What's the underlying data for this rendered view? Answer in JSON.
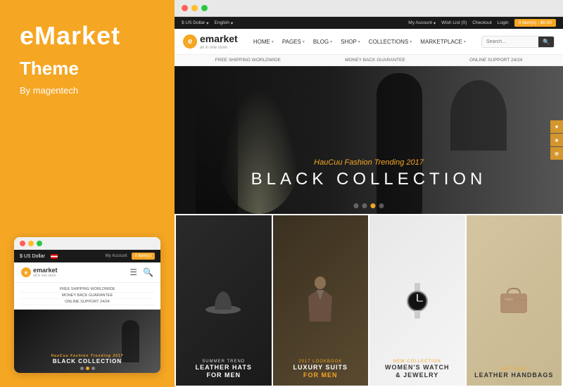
{
  "leftPanel": {
    "brandName": "eMarket",
    "themeLabel": "Theme",
    "byAuthor": "By magentech"
  },
  "mobileSite": {
    "currency": "$ US Dollar",
    "flag": "US",
    "account": "My Account",
    "cartLabel": "0 item(s)",
    "logoText": "emarket",
    "logoSub": "all in one store",
    "taglines": [
      "FREE SHIPPING WORLDWIDE",
      "MONEY BACK GUARANTEE",
      "ONLINE SUPPORT 24/24"
    ],
    "heroSub": "HauCuu Fashion Trending 2017",
    "heroMain": "BLACK COLLECTION"
  },
  "desktopSite": {
    "topbar": {
      "currency": "$ US Dollar",
      "english": "English",
      "account": "My Account",
      "wishlist": "Wish List (0)",
      "checkout": "Checkout",
      "login": "Login",
      "cart": "0 item(s) - $0.00"
    },
    "nav": {
      "logoText": "emarket",
      "logoSub": "all in one store",
      "menuItems": [
        "HOME",
        "PAGES",
        "BLOG",
        "SHOP",
        "COLLECTIONS",
        "MARKETPLACE"
      ],
      "searchPlaceholder": "Search..."
    },
    "taglines": [
      "FREE SHIPPING WORLDWIDE",
      "MONEY BACK GUARANTEE",
      "ONLINE SUPPORT 24/24"
    ],
    "hero": {
      "scriptText": "HauCuu Fashion Trending 2017",
      "mainText": "BLACK COLLECTION"
    },
    "products": [
      {
        "id": "hats",
        "tag": "Summer Trend",
        "title": "LEATHER HATS\nFOR MEN",
        "bgClass": "tile-hats"
      },
      {
        "id": "suits",
        "tag": "2017 Lookbook",
        "title": "LUXURY SUITS\nFOR MEN",
        "bgClass": "tile-suits",
        "accent": true
      },
      {
        "id": "watch",
        "tag": "New Collection",
        "title": "WOMEN'S WATCH\n& JEWELRY",
        "bgClass": "tile-watch",
        "dark": true
      },
      {
        "id": "handbags",
        "tag": "Hot Sale",
        "title": "LEATHER HANDBAGS",
        "bgClass": "tile-handbags",
        "dark": true
      }
    ]
  },
  "colors": {
    "accent": "#F5A623",
    "dark": "#1a1a1a",
    "white": "#ffffff"
  },
  "icons": {
    "search": "🔍",
    "menu": "☰",
    "cart": "🛒",
    "chevron": "▾",
    "close": "✕",
    "minimize": "−",
    "maximize": "□"
  }
}
